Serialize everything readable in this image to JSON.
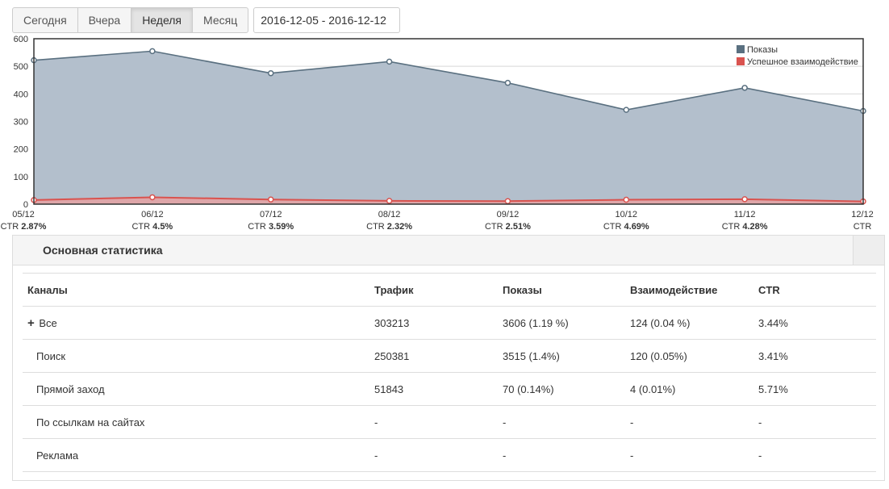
{
  "toolbar": {
    "periods": [
      "Сегодня",
      "Вчера",
      "Неделя",
      "Месяц"
    ],
    "active_period": "Неделя",
    "date_range": "2016-12-05 - 2016-12-12"
  },
  "chart_data": {
    "type": "area",
    "categories": [
      "05/12",
      "06/12",
      "07/12",
      "08/12",
      "09/12",
      "10/12",
      "11/12",
      "12/12"
    ],
    "series": [
      {
        "name": "Показы",
        "values": [
          522,
          555,
          475,
          517,
          440,
          342,
          422,
          338
        ],
        "color": "#5a7080"
      },
      {
        "name": "Успешное взаимодействие",
        "values": [
          15,
          25,
          17,
          12,
          11,
          16,
          18,
          10
        ],
        "color": "#d9534f"
      }
    ],
    "ctr_labels": [
      {
        "prefix": "CTR",
        "value": "2.87%"
      },
      {
        "prefix": "CTR",
        "value": "4.5%"
      },
      {
        "prefix": "CTR",
        "value": "3.59%"
      },
      {
        "prefix": "CTR",
        "value": "2.32%"
      },
      {
        "prefix": "CTR",
        "value": "2.51%"
      },
      {
        "prefix": "CTR",
        "value": "4.69%"
      },
      {
        "prefix": "CTR",
        "value": "4.28%"
      },
      {
        "prefix": "CTR",
        "value": ""
      }
    ],
    "y_ticks": [
      0,
      100,
      200,
      300,
      400,
      500,
      600
    ],
    "ylim": [
      0,
      600
    ],
    "grid": true,
    "legend_position": "top-right",
    "fill_color": "#b3bfcc"
  },
  "stats": {
    "title": "Основная статистика",
    "columns": [
      "Каналы",
      "Трафик",
      "Показы",
      "Взаимодействие",
      "CTR"
    ],
    "rows": [
      {
        "expand": "+",
        "cells": [
          "Все",
          "303213",
          "3606 (1.19 %)",
          "124 (0.04 %)",
          "3.44%"
        ]
      },
      {
        "cells": [
          "Поиск",
          "250381",
          "3515 (1.4%)",
          "120 (0.05%)",
          "3.41%"
        ]
      },
      {
        "cells": [
          "Прямой заход",
          "51843",
          "70 (0.14%)",
          "4 (0.01%)",
          "5.71%"
        ]
      },
      {
        "cells": [
          "По ссылкам на сайтах",
          "-",
          "-",
          "-",
          "-"
        ]
      },
      {
        "cells": [
          "Реклама",
          "-",
          "-",
          "-",
          "-"
        ]
      }
    ]
  }
}
